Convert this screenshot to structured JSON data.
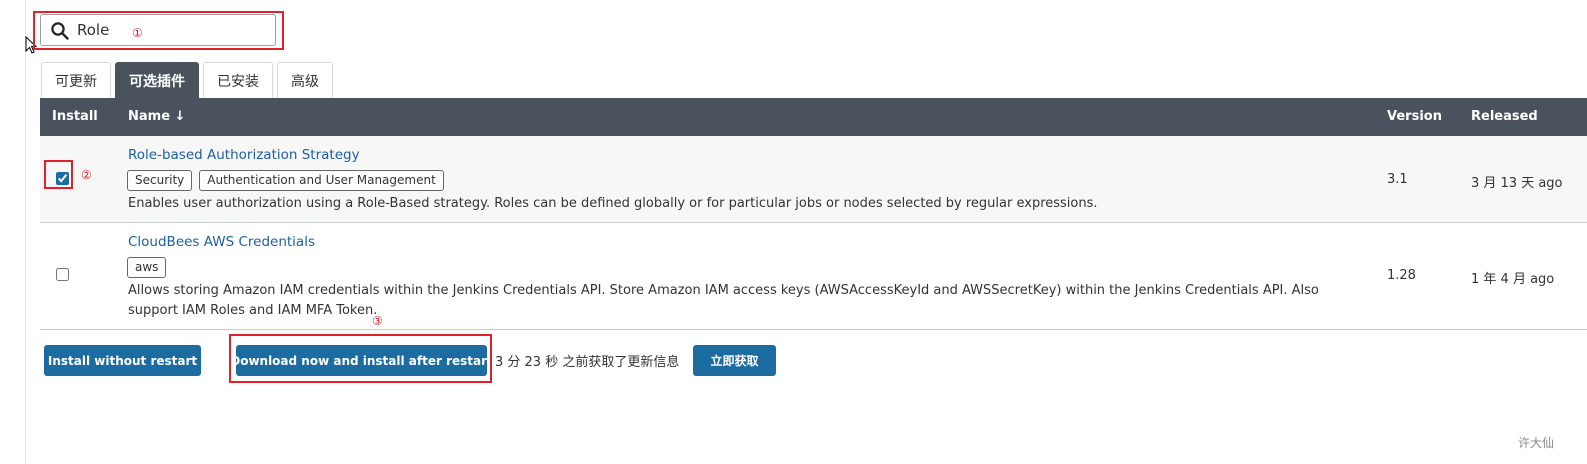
{
  "search": {
    "value": "Role",
    "placeholder": ""
  },
  "tabs": [
    {
      "label": "可更新",
      "active": false
    },
    {
      "label": "可选插件",
      "active": true
    },
    {
      "label": "已安装",
      "active": false
    },
    {
      "label": "高级",
      "active": false
    }
  ],
  "table": {
    "headers": {
      "install": "Install",
      "name": "Name ↓",
      "version": "Version",
      "released": "Released"
    },
    "rows": [
      {
        "name": "Role-based Authorization Strategy",
        "tags": [
          "Security",
          "Authentication and User Management"
        ],
        "description": "Enables user authorization using a Role-Based strategy. Roles can be defined globally or for particular jobs or nodes selected by regular expressions.",
        "version": "3.1",
        "released": "3 月 13 天 ago",
        "checked": true
      },
      {
        "name": "CloudBees AWS Credentials",
        "tags": [
          "aws"
        ],
        "description": "Allows storing Amazon IAM credentials within the Jenkins Credentials API. Store Amazon IAM access keys (AWSAccessKeyId and AWSSecretKey) within the Jenkins Credentials API. Also support IAM Roles and IAM MFA Token.",
        "version": "1.28",
        "released": "1 年 4 月 ago",
        "checked": false
      }
    ]
  },
  "actions": {
    "install_without_restart": "Install without restart",
    "download_install_after_restart": "Download now and install after restart",
    "update_info": "3 分 23 秒 之前获取了更新信息",
    "fetch_now": "立即获取"
  },
  "annotations": {
    "mark1": "①",
    "mark2": "②",
    "mark3": "③"
  },
  "watermark": "许大仙",
  "colors": {
    "accent": "#1c6ca1",
    "header_bg": "#4a535d",
    "link": "#1d5fa4",
    "annotation_red": "#e0202a"
  }
}
